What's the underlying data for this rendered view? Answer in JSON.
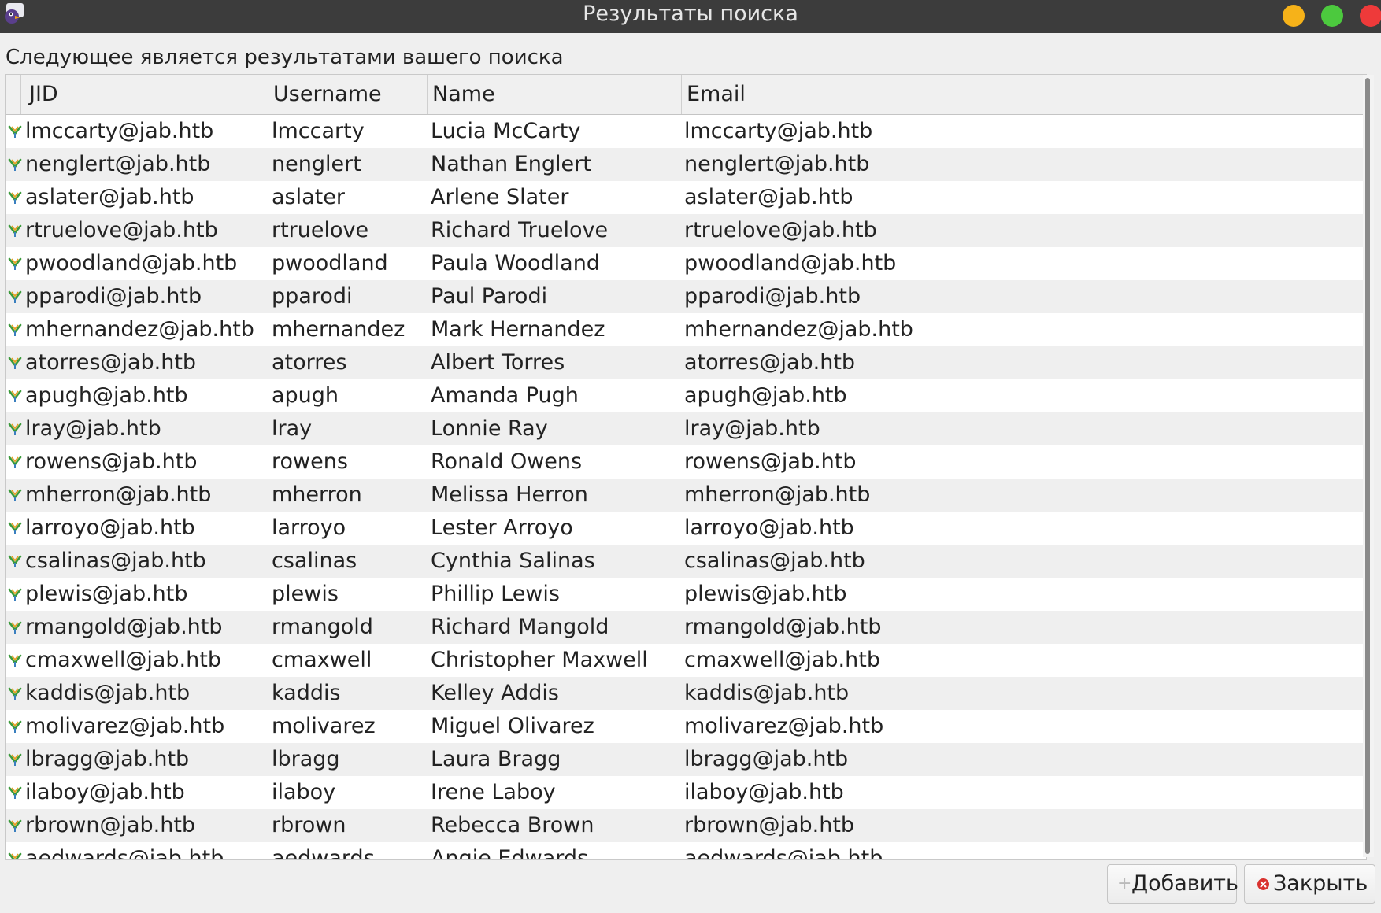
{
  "window": {
    "title": "Результаты поиска"
  },
  "subtitle": "Следующее является результатами вашего поиска",
  "columns": {
    "jid": "JID",
    "username": "Username",
    "name": "Name",
    "email": "Email"
  },
  "rows": [
    {
      "jid": "lmccarty@jab.htb",
      "username": "lmccarty",
      "name": "Lucia McCarty",
      "email": "lmccarty@jab.htb"
    },
    {
      "jid": "nenglert@jab.htb",
      "username": "nenglert",
      "name": "Nathan Englert",
      "email": "nenglert@jab.htb"
    },
    {
      "jid": "aslater@jab.htb",
      "username": "aslater",
      "name": "Arlene Slater",
      "email": "aslater@jab.htb"
    },
    {
      "jid": "rtruelove@jab.htb",
      "username": "rtruelove",
      "name": "Richard Truelove",
      "email": "rtruelove@jab.htb"
    },
    {
      "jid": "pwoodland@jab.htb",
      "username": "pwoodland",
      "name": "Paula Woodland",
      "email": "pwoodland@jab.htb"
    },
    {
      "jid": "pparodi@jab.htb",
      "username": "pparodi",
      "name": "Paul Parodi",
      "email": "pparodi@jab.htb"
    },
    {
      "jid": "mhernandez@jab.htb",
      "username": "mhernandez",
      "name": "Mark Hernandez",
      "email": "mhernandez@jab.htb"
    },
    {
      "jid": "atorres@jab.htb",
      "username": "atorres",
      "name": "Albert Torres",
      "email": "atorres@jab.htb"
    },
    {
      "jid": "apugh@jab.htb",
      "username": "apugh",
      "name": "Amanda Pugh",
      "email": "apugh@jab.htb"
    },
    {
      "jid": "lray@jab.htb",
      "username": "lray",
      "name": "Lonnie Ray",
      "email": "lray@jab.htb"
    },
    {
      "jid": "rowens@jab.htb",
      "username": "rowens",
      "name": "Ronald Owens",
      "email": "rowens@jab.htb"
    },
    {
      "jid": "mherron@jab.htb",
      "username": "mherron",
      "name": "Melissa Herron",
      "email": "mherron@jab.htb"
    },
    {
      "jid": "larroyo@jab.htb",
      "username": "larroyo",
      "name": "Lester Arroyo",
      "email": "larroyo@jab.htb"
    },
    {
      "jid": "csalinas@jab.htb",
      "username": "csalinas",
      "name": "Cynthia Salinas",
      "email": "csalinas@jab.htb"
    },
    {
      "jid": "plewis@jab.htb",
      "username": "plewis",
      "name": "Phillip Lewis",
      "email": "plewis@jab.htb"
    },
    {
      "jid": "rmangold@jab.htb",
      "username": "rmangold",
      "name": "Richard Mangold",
      "email": "rmangold@jab.htb"
    },
    {
      "jid": "cmaxwell@jab.htb",
      "username": "cmaxwell",
      "name": "Christopher Maxwell",
      "email": "cmaxwell@jab.htb"
    },
    {
      "jid": "kaddis@jab.htb",
      "username": "kaddis",
      "name": "Kelley Addis",
      "email": "kaddis@jab.htb"
    },
    {
      "jid": "molivarez@jab.htb",
      "username": "molivarez",
      "name": "Miguel Olivarez",
      "email": "molivarez@jab.htb"
    },
    {
      "jid": "lbragg@jab.htb",
      "username": "lbragg",
      "name": "Laura Bragg",
      "email": "lbragg@jab.htb"
    },
    {
      "jid": "ilaboy@jab.htb",
      "username": "ilaboy",
      "name": "Irene Laboy",
      "email": "ilaboy@jab.htb"
    },
    {
      "jid": "rbrown@jab.htb",
      "username": "rbrown",
      "name": "Rebecca Brown",
      "email": "rbrown@jab.htb"
    },
    {
      "jid": "aedwards@jab.htb",
      "username": "aedwards",
      "name": "Angie Edwards",
      "email": "aedwards@jab.htb"
    }
  ],
  "buttons": {
    "add": "Добавить",
    "close": "Закрыть"
  },
  "icons": {
    "app": "pidgin-icon",
    "row": "xmpp-user-icon",
    "add": "plus-icon",
    "close": "close-circle-icon"
  },
  "colors": {
    "titlebar": "#3c3c3c",
    "minimize": "#f6b219",
    "maximize": "#4cc93e",
    "close": "#ee3a3a"
  }
}
